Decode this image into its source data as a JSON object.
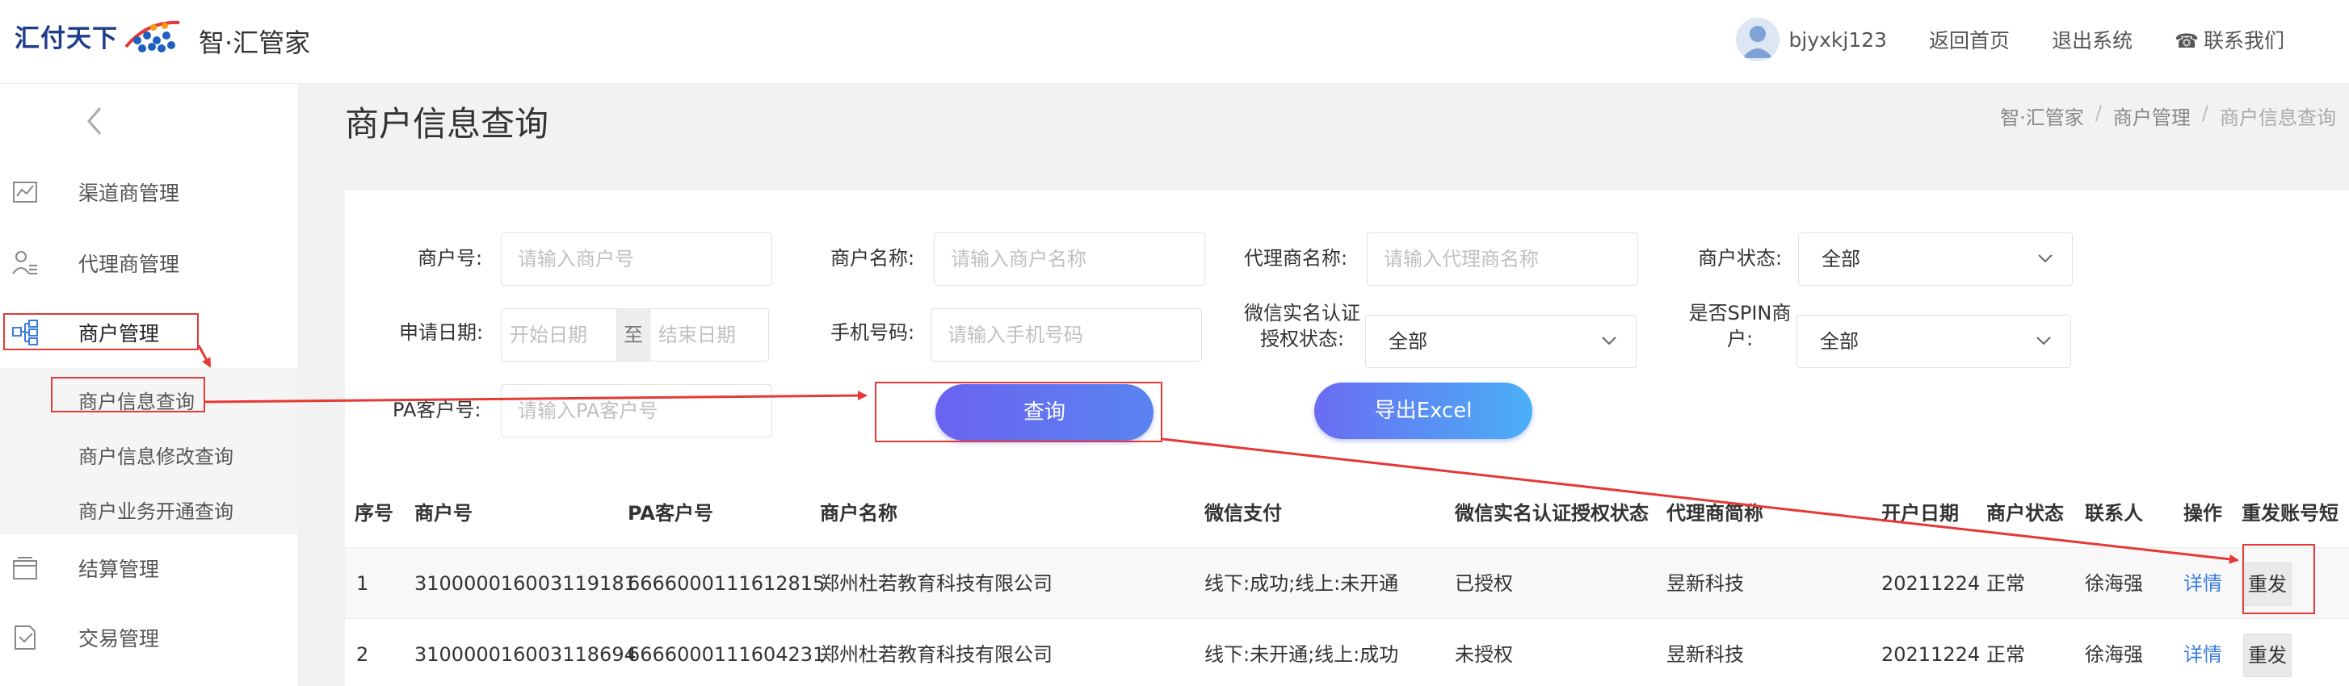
{
  "header": {
    "logo_text": "汇付天下",
    "app_name": "智·汇管家",
    "username": "bjyxkj123",
    "home_link": "返回首页",
    "logout_link": "退出系统",
    "contact_link": "联系我们"
  },
  "sidebar": {
    "items": [
      {
        "label": "渠道商管理",
        "icon": "chart-icon"
      },
      {
        "label": "代理商管理",
        "icon": "user-list-icon"
      },
      {
        "label": "商户管理",
        "icon": "org-tree-icon"
      },
      {
        "label": "结算管理",
        "icon": "wallet-icon"
      },
      {
        "label": "交易管理",
        "icon": "document-icon"
      }
    ],
    "sub_items": [
      {
        "label": "商户信息查询"
      },
      {
        "label": "商户信息修改查询"
      },
      {
        "label": "商户业务开通查询"
      }
    ]
  },
  "page": {
    "title": "商户信息查询",
    "breadcrumb": [
      "智·汇管家",
      "商户管理",
      "商户信息查询"
    ]
  },
  "form": {
    "merchant_no_label": "商户号:",
    "merchant_no_placeholder": "请输入商户号",
    "merchant_name_label": "商户名称:",
    "merchant_name_placeholder": "请输入商户名称",
    "agent_name_label": "代理商名称:",
    "agent_name_placeholder": "请输入代理商名称",
    "status_label": "商户状态:",
    "status_value": "全部",
    "date_label": "申请日期:",
    "date_start": "开始日期",
    "date_to": "至",
    "date_end": "结束日期",
    "phone_label": "手机号码:",
    "phone_placeholder": "请输入手机号码",
    "wechat_label_line1": "微信实名认证",
    "wechat_label_line2": "授权状态:",
    "wechat_value": "全部",
    "spin_label_line1": "是否SPIN商",
    "spin_label_line2": "户:",
    "spin_value": "全部",
    "pa_label": "PA客户号:",
    "pa_placeholder": "请输入PA客户号",
    "query_button": "查询",
    "export_button": "导出Excel"
  },
  "table": {
    "headers": [
      "序号",
      "商户号",
      "PA客户号",
      "商户名称",
      "微信支付",
      "微信实名认证授权状态",
      "代理商简称",
      "开户日期",
      "商户状态",
      "联系人",
      "操作",
      "重发账号短"
    ],
    "rows": [
      {
        "no": "1",
        "merchant_no": "310000016003119181",
        "pa_no": "6666000111612815",
        "name": "郑州杜若教育科技有限公司",
        "wechat_pay": "线下:成功;线上:未开通",
        "auth_status": "已授权",
        "agent": "昱新科技",
        "open_date": "20211224",
        "status": "正常",
        "contact": "徐海强",
        "action": "详情",
        "resend": "重发"
      },
      {
        "no": "2",
        "merchant_no": "310000016003118694",
        "pa_no": "6666000111604231",
        "name": "郑州杜若教育科技有限公司",
        "wechat_pay": "线下:未开通;线上:成功",
        "auth_status": "未授权",
        "agent": "昱新科技",
        "open_date": "20211224",
        "status": "正常",
        "contact": "徐海强",
        "action": "详情",
        "resend": "重发"
      }
    ]
  },
  "colors": {
    "annotation_red": "#e53935",
    "link_blue": "#3b7ddd",
    "query_gradient": [
      "#6a63f0",
      "#5a84f0"
    ],
    "export_gradient": [
      "#6a6cf2",
      "#4ab0f6"
    ]
  }
}
